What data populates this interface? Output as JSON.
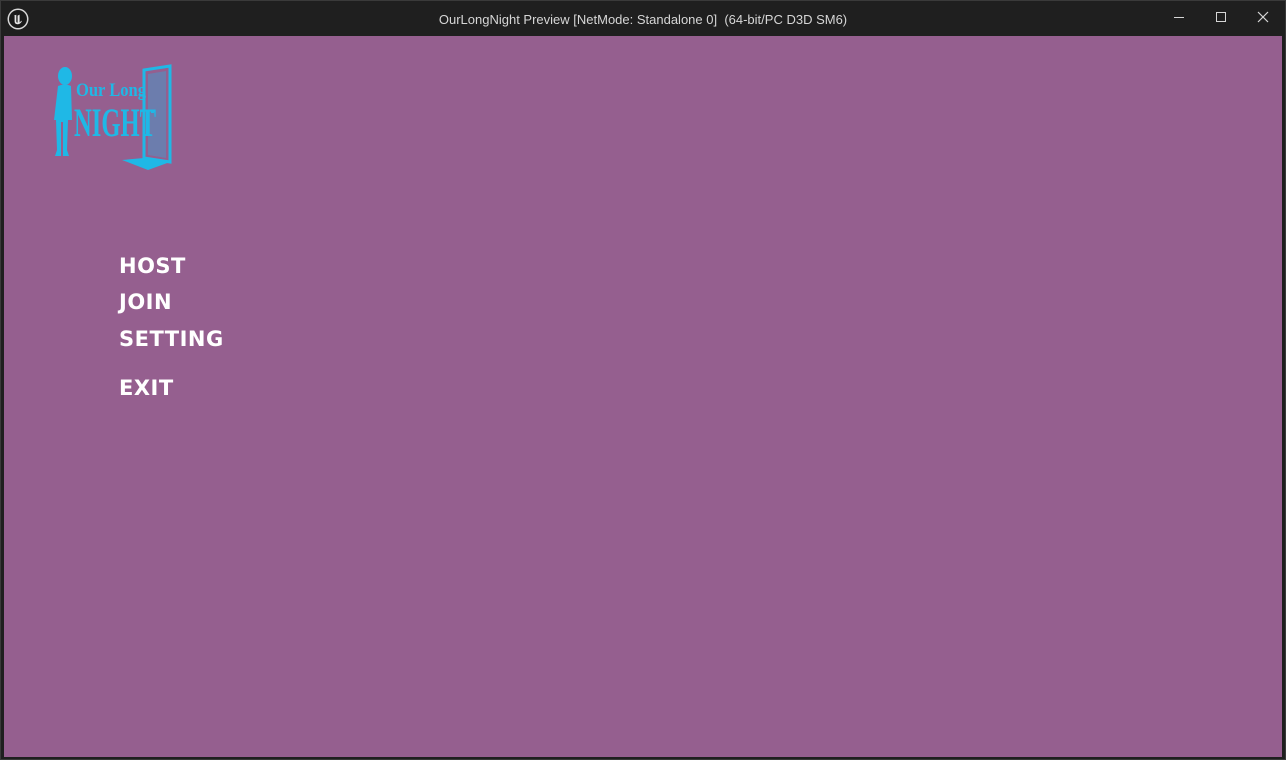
{
  "window": {
    "title": "OurLongNight Preview [NetMode: Standalone 0]  (64-bit/PC D3D SM6)",
    "app_icon": "unreal-engine-logo-icon",
    "controls": {
      "minimize_icon": "minimize-icon",
      "maximize_icon": "maximize-icon",
      "close_icon": "close-icon"
    }
  },
  "game": {
    "logo": {
      "text_line1": "Our Long",
      "text_line2": "NIGHT",
      "color": "#1fb8e6"
    },
    "menu": {
      "host_label": "HOST",
      "join_label": "JOIN",
      "setting_label": "SETTING",
      "exit_label": "EXIT"
    },
    "background_color": "#955f8f"
  }
}
